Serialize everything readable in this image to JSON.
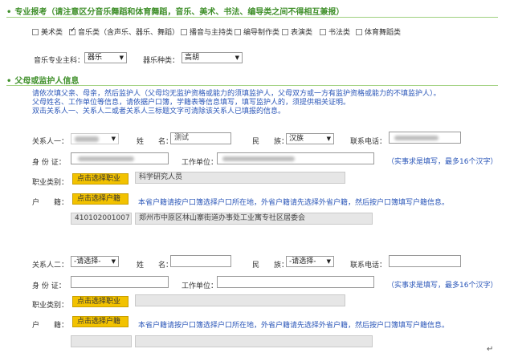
{
  "specialty": {
    "title": "专业报考（请注意区分音乐舞蹈和体育舞蹈，音乐、美术、书法、编导类之间不得相互兼报）",
    "categories": [
      {
        "label": "美术类",
        "checked": false
      },
      {
        "label": "音乐类（含声乐、器乐、舞蹈）",
        "checked": true
      },
      {
        "label": "播音与主持类",
        "checked": false
      },
      {
        "label": "编导制作类",
        "checked": false
      },
      {
        "label": "表演类",
        "checked": false
      },
      {
        "label": "书法类",
        "checked": false
      },
      {
        "label": "体育舞蹈类",
        "checked": false
      }
    ],
    "major_label": "音乐专业主科：",
    "major_value": "器乐",
    "instrument_label": "器乐种类：",
    "instrument_value": "高胡"
  },
  "guardian": {
    "title": "父母或监护人信息",
    "notes": [
      "请依次填父亲、母亲，然后监护人（父母均无监护资格或能力的须填监护人，父母双方或一方有监护资格或能力的不填监护人）。",
      "父母姓名、工作单位等信息，请依据户口簿，学籍表等信息填写，填写监护人的，须提供相关证明。",
      "双击关系人一、关系人二或者关系人三标题文字可清除该关系人已填报的信息。"
    ],
    "relation1": {
      "relation_label": "关系人一：",
      "name_label": "姓　　名：",
      "name_value": "测试",
      "ethnic_label": "民　　族：",
      "ethnic_value": "汉族",
      "phone_label": "联系电话：",
      "id_label": "身 份 证：",
      "work_label": "工作单位：",
      "work_hint": "（实事求是填写，最多16个汉字）",
      "job_label": "职业类别：",
      "job_button": "点击选择职业",
      "job_value": "科学研究人员",
      "hukou_label": "户　　籍：",
      "hukou_button": "点击选择户籍",
      "hukou_hint": "本省户籍请按户口簿选择户口所在地，外省户籍请先选择外省户籍，然后按户口簿填写户籍信息。",
      "hukou_code": "410102001007",
      "hukou_address": "郑州市中原区林山寨街道办事处工业寓专社区居委会"
    },
    "relation2": {
      "relation_label": "关系人二：",
      "relation_value": "-请选择-",
      "name_label": "姓　　名：",
      "ethnic_label": "民　　族：",
      "ethnic_value": "-请选择-",
      "phone_label": "联系电话：",
      "id_label": "身 份 证：",
      "work_label": "工作单位：",
      "work_hint": "（实事求是填写，最多16个汉字）",
      "job_label": "职业类别：",
      "job_button": "点击选择职业",
      "hukou_label": "户　　籍：",
      "hukou_button": "点击选择户籍",
      "hukou_hint": "本省户籍请按户口簿选择户口所在地，外省户籍请先选择外省户籍，然后按户口簿填写户籍信息。"
    }
  },
  "icons": {
    "section_bullet": "•",
    "dropdown": "▼",
    "return_mark": "↵"
  }
}
